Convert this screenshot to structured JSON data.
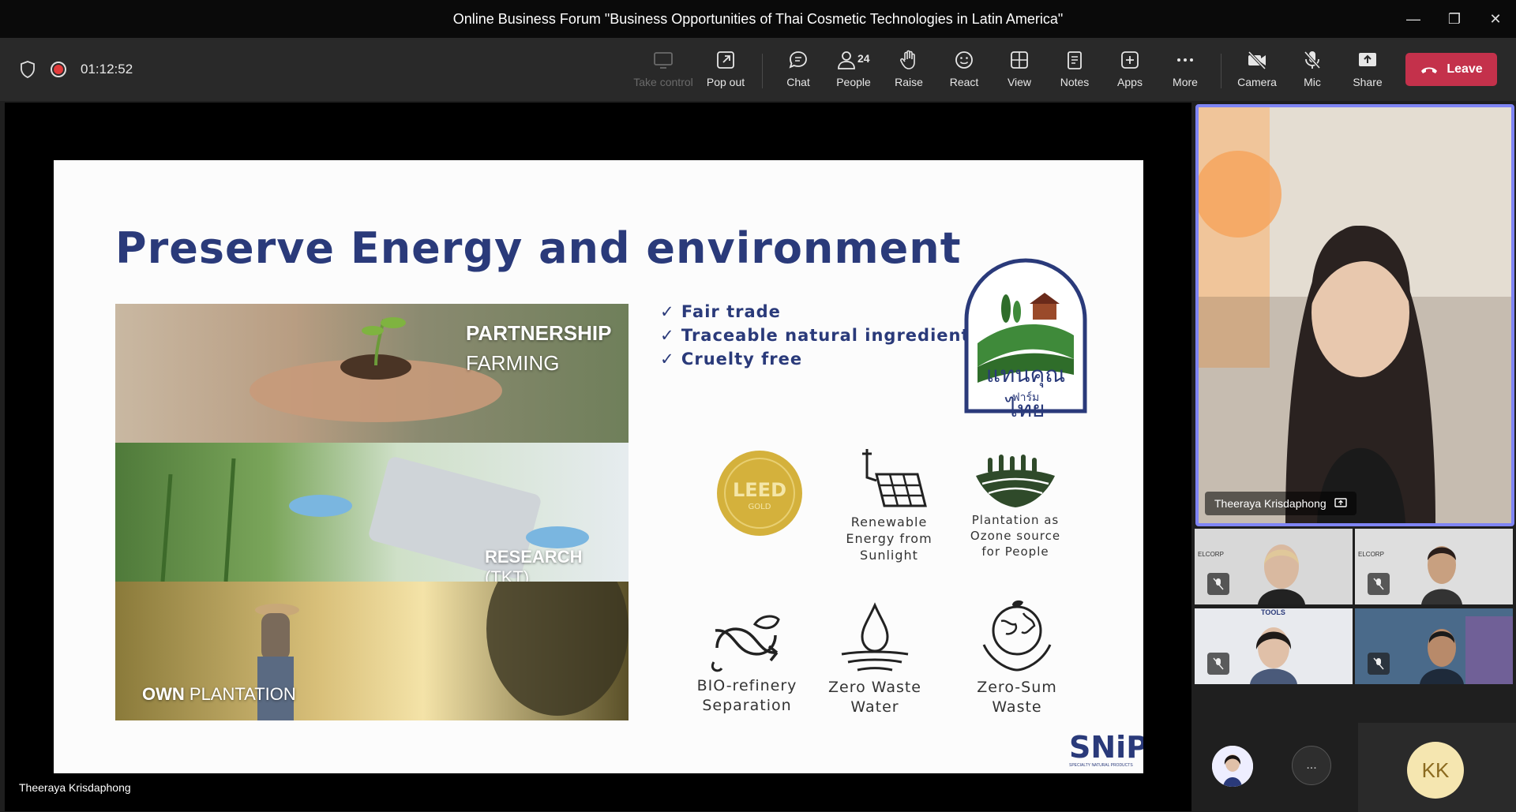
{
  "window": {
    "title": "Online Business Forum \"Business Opportunities of Thai Cosmetic Technologies in Latin America\""
  },
  "toolbar": {
    "timer": "01:12:52",
    "take_control": "Take control",
    "pop_out": "Pop out",
    "chat": "Chat",
    "people": "People",
    "people_count": "24",
    "raise": "Raise",
    "react": "React",
    "view": "View",
    "notes": "Notes",
    "apps": "Apps",
    "more": "More",
    "camera": "Camera",
    "mic": "Mic",
    "share": "Share",
    "leave": "Leave"
  },
  "slide": {
    "title": "Preserve Energy and environment",
    "photos": {
      "partnership_1": "PARTNERSHIP",
      "partnership_2": "FARMING",
      "research_1": "RESEARCH",
      "research_2": "(TKT)",
      "own_1": "OWN",
      "own_2": "PLANTATION"
    },
    "checklist": [
      "Fair trade",
      "Traceable natural ingredients",
      "Cruelty free"
    ],
    "thai_logo": {
      "line1": "แทนคุณไทย",
      "line2": "ฟาร์ม"
    },
    "leed": {
      "main": "LEED",
      "sub": "GOLD"
    },
    "features": {
      "renewable": [
        "Renewable",
        "Energy from",
        "Sunlight"
      ],
      "plantation": [
        "Plantation as",
        "Ozone source",
        "for People"
      ],
      "bio": [
        "BIO-refinery",
        "Separation"
      ],
      "water": [
        "Zero Waste",
        "Water"
      ],
      "sum": [
        "Zero-Sum Waste"
      ]
    },
    "brand": "SNiPS",
    "brand_sub": "SPECIALTY NATURAL PRODUCTS"
  },
  "stage": {
    "presenter_name": "Theeraya Krisdaphong"
  },
  "participants": {
    "speaker_name": "Theeraya Krisdaphong",
    "thumb_badge_1": "ELCORP",
    "thumb_badge_2": "ELCORP",
    "thumb_badge_3": "TOOLS",
    "more": "...",
    "initials": "KK"
  },
  "colors": {
    "leave": "#c4314b",
    "accent": "#7f85f5",
    "slide_navy": "#2a3a7a",
    "recording": "#e23b3b"
  }
}
